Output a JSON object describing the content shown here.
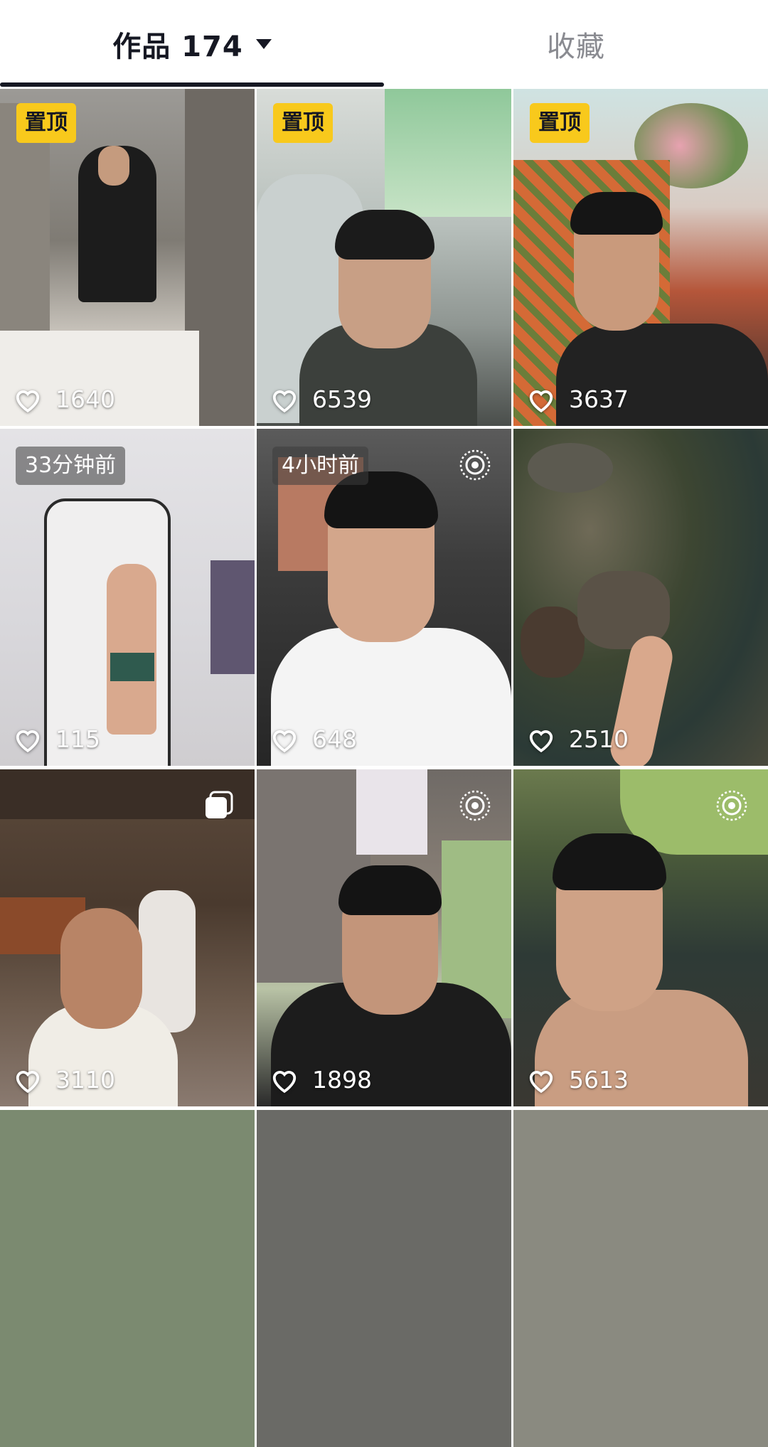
{
  "tabs": {
    "works_label": "作品 174",
    "favorites_label": "收藏"
  },
  "badges": {
    "pinned": "置顶"
  },
  "posts": [
    {
      "likes": "1640",
      "badge": "置顶"
    },
    {
      "likes": "6539",
      "badge": "置顶"
    },
    {
      "likes": "3637",
      "badge": "置顶"
    },
    {
      "likes": "115",
      "badge": "33分钟前"
    },
    {
      "likes": "648",
      "badge": "4小时前",
      "icon": "live-photo-icon"
    },
    {
      "likes": "2510"
    },
    {
      "likes": "3110",
      "icon": "multi-image-icon"
    },
    {
      "likes": "1898",
      "icon": "live-photo-icon"
    },
    {
      "likes": "5613",
      "icon": "live-photo-icon"
    }
  ]
}
